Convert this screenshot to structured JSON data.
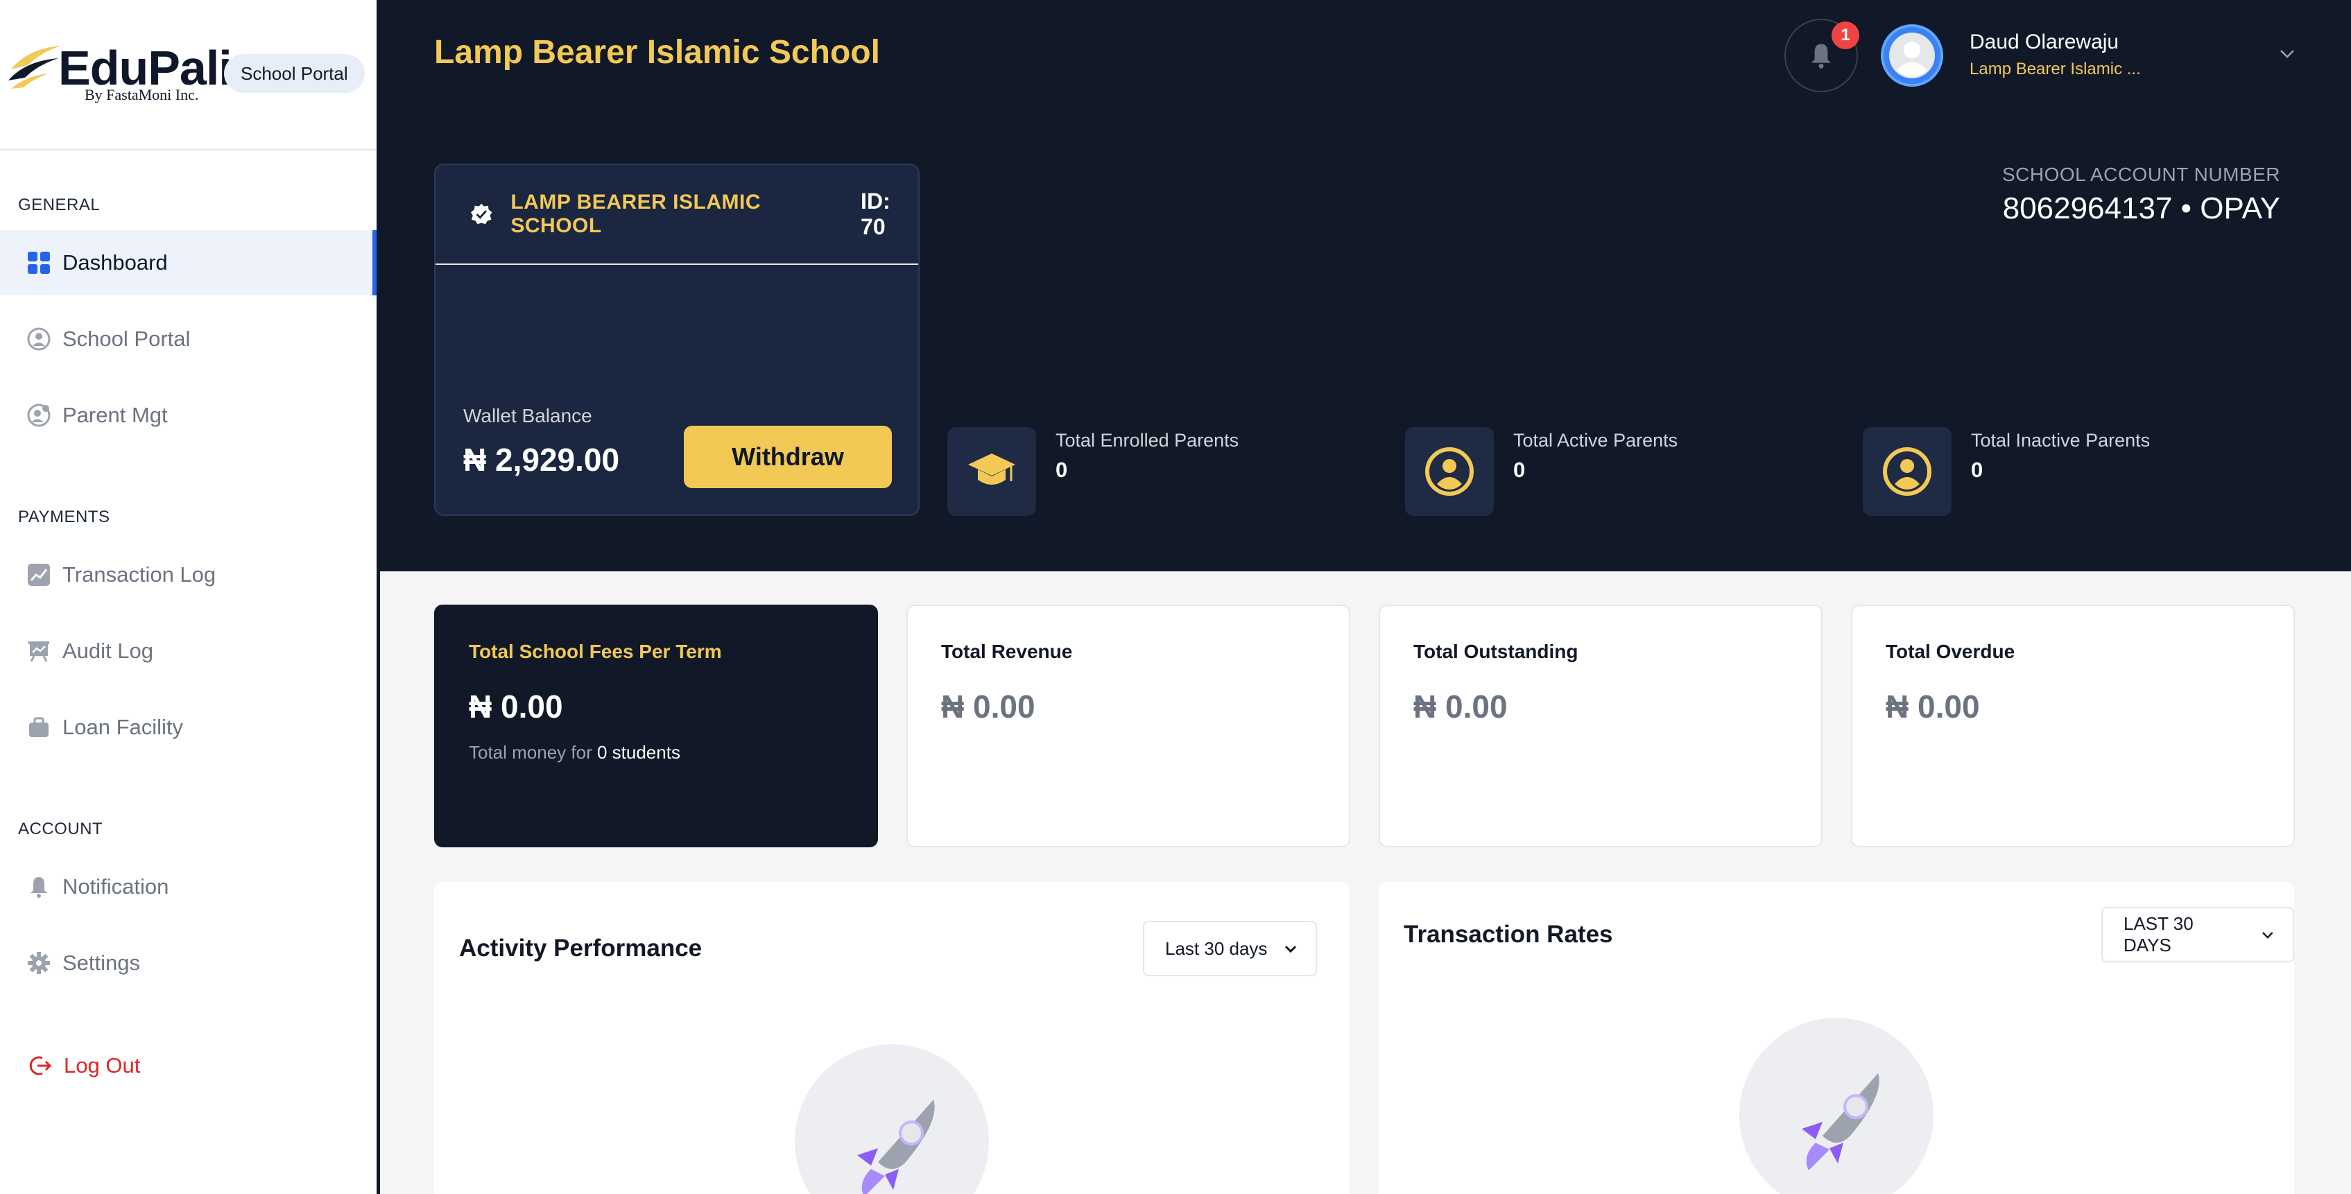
{
  "brand": {
    "logo_text": "EduPali",
    "logo_byline": "By FastaMoni Inc.",
    "portal_badge": "School Portal",
    "colors": {
      "navy": "#111827",
      "gold": "#f2c955",
      "accent": "#2563eb",
      "danger": "#dc2626"
    }
  },
  "sidebar": {
    "sections": [
      {
        "title": "GENERAL",
        "items": [
          {
            "label": "Dashboard",
            "icon": "grid-icon",
            "active": true
          },
          {
            "label": "School Portal",
            "icon": "user-circle-icon"
          },
          {
            "label": "Parent Mgt",
            "icon": "user-gear-icon"
          }
        ]
      },
      {
        "title": "PAYMENTS",
        "items": [
          {
            "label": "Transaction Log",
            "icon": "chart-line-icon"
          },
          {
            "label": "Audit Log",
            "icon": "presentation-icon"
          },
          {
            "label": "Loan Facility",
            "icon": "briefcase-icon"
          }
        ]
      },
      {
        "title": "ACCOUNT",
        "items": [
          {
            "label": "Notification",
            "icon": "bell-icon"
          },
          {
            "label": "Settings",
            "icon": "gear-icon"
          }
        ]
      }
    ],
    "logout": {
      "label": "Log Out",
      "icon": "logout-icon"
    }
  },
  "header": {
    "school_title": "Lamp Bearer Islamic School",
    "notification_count": "1",
    "user": {
      "name": "Daud Olarewaju",
      "school": "Lamp Bearer Islamic ..."
    },
    "account": {
      "label": "SCHOOL ACCOUNT NUMBER",
      "number": "8062964137 • OPAY"
    }
  },
  "wallet": {
    "school_name": "LAMP BEARER ISLAMIC SCHOOL",
    "id_label": "ID: 70",
    "balance_label": "Wallet Balance",
    "balance": "₦ 2,929.00",
    "withdraw_label": "Withdraw"
  },
  "stats": [
    {
      "label": "Total Enrolled Parents",
      "value": "0",
      "icon": "graduation-cap-icon"
    },
    {
      "label": "Total Active Parents",
      "value": "0",
      "icon": "user-circle-icon"
    },
    {
      "label": "Total Inactive Parents",
      "value": "0",
      "icon": "user-circle-icon"
    }
  ],
  "finance_cards": [
    {
      "title": "Total School Fees Per Term",
      "value": "₦ 0.00",
      "sub_prefix": "Total money for",
      "sub_value": "0 students"
    },
    {
      "title": "Total Revenue",
      "value": "₦ 0.00"
    },
    {
      "title": "Total Outstanding",
      "value": "₦ 0.00"
    },
    {
      "title": "Total Overdue",
      "value": "₦ 0.00"
    }
  ],
  "panels": {
    "activity": {
      "title": "Activity Performance",
      "range": "Last 30 days"
    },
    "transactions": {
      "title": "Transaction Rates",
      "range": "LAST 30 DAYS"
    }
  }
}
